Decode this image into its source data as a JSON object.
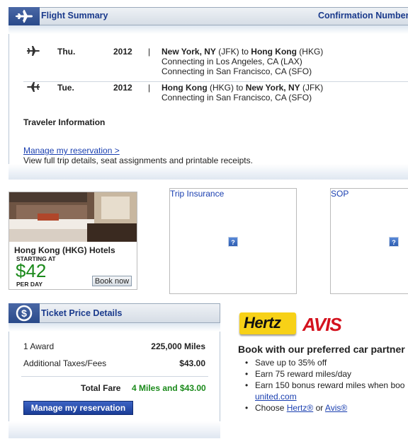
{
  "flight_summary": {
    "title": "Flight Summary",
    "confirmation_label": "Confirmation Number:",
    "flights": [
      {
        "day": "Thu.",
        "year": "2012",
        "separator": "|",
        "from_city": "New York, NY",
        "from_code": "(JFK)",
        "to_word": "to",
        "to_city": "Hong Kong",
        "to_code": "(HKG)",
        "connections": [
          "Connecting in Los Angeles, CA (LAX)",
          "Connecting in San Francisco, CA (SFO)"
        ]
      },
      {
        "day": "Tue.",
        "year": "2012",
        "separator": "|",
        "from_city": "Hong Kong",
        "from_code": "(HKG)",
        "to_word": "to",
        "to_city": "New York, NY",
        "to_code": "(JFK)",
        "connections": [
          "Connecting in San Francisco, CA (SFO)"
        ]
      }
    ],
    "traveler_heading": "Traveler Information",
    "manage_link": "Manage my reservation >",
    "manage_desc": "View full trip details, seat assignments and printable receipts."
  },
  "hotel_ad": {
    "title": "Hong Kong (HKG) Hotels",
    "starting_at": "STARTING AT",
    "price": "$42",
    "per_day": "PER DAY",
    "button": "Book now"
  },
  "ads": {
    "trip_insurance": "Trip Insurance",
    "sop": "SOP",
    "placeholder_glyph": "?"
  },
  "ticket_price": {
    "title": "Ticket Price Details",
    "rows": [
      {
        "label": "1 Award",
        "value": "225,000 Miles"
      },
      {
        "label": "Additional Taxes/Fees",
        "value": "$43.00"
      }
    ],
    "total_label": "Total Fare",
    "total_value": "4 Miles and $43.00",
    "button": "Manage my reservation"
  },
  "car_rental": {
    "hertz_logo": "Hertz",
    "avis_logo": "AVIS",
    "heading": "Book with our preferred car partner",
    "bullets": [
      "Save up to 35% off",
      "Earn 75 reward miles/day",
      "Earn 150 bonus reward miles when boo"
    ],
    "united_link": "united.com",
    "choose_prefix": "Choose",
    "hertz_link": "Hertz®",
    "or_word": "or",
    "avis_link": "Avis®"
  },
  "colors": {
    "link": "#1a3fb0",
    "panel_title": "#1a3a8c",
    "price_green": "#1b8a1b",
    "total_green": "#1b8a1b",
    "hertz_yellow": "#f7d117",
    "avis_red": "#d4121e"
  },
  "icons": {
    "flight_summary": "airplane-icon",
    "flight_row": "airplane-icon",
    "ticket_price": "dollar-circle-icon",
    "ad_placeholder": "question-icon"
  }
}
